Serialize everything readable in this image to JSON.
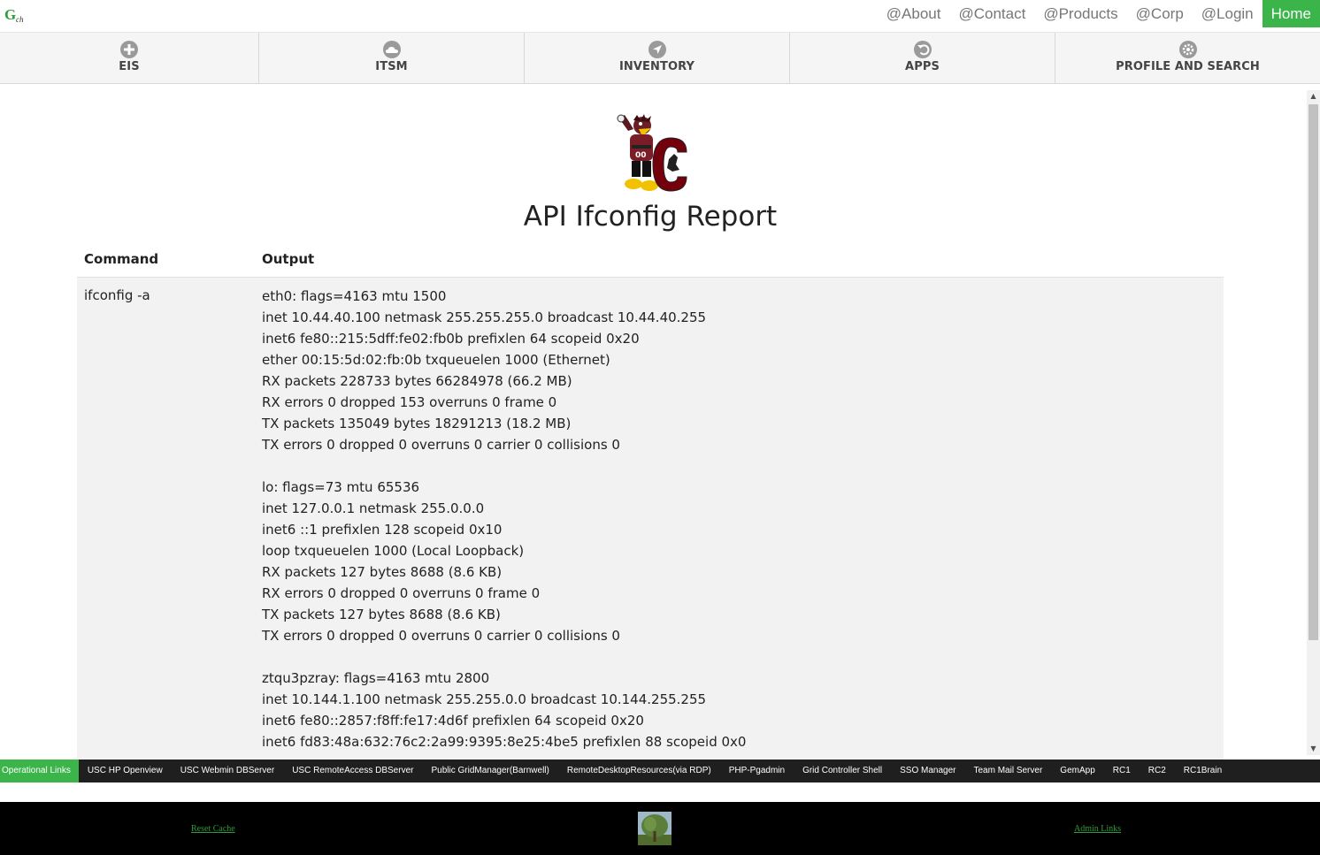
{
  "topnav": {
    "links": [
      "@About",
      "@Contact",
      "@Products",
      "@Corp",
      "@Login"
    ],
    "home": "Home",
    "colors": {
      "accent": "#3bb54a",
      "link": "#777777"
    }
  },
  "tabs": [
    {
      "label": "EIS",
      "icon": "plus-circle-icon"
    },
    {
      "label": "ITSM",
      "icon": "cloud-icon"
    },
    {
      "label": "INVENTORY",
      "icon": "navigation-arrow-icon"
    },
    {
      "label": "APPS",
      "icon": "refresh-back-icon"
    },
    {
      "label": "PROFILE AND SEARCH",
      "icon": "gear-icon"
    }
  ],
  "main": {
    "title": "API Ifconfig Report",
    "table": {
      "headers": [
        "Command",
        "Output"
      ],
      "command": "ifconfig -a",
      "output_lines": [
        "eth0: flags=4163 mtu 1500",
        "inet 10.44.40.100 netmask 255.255.255.0 broadcast 10.44.40.255",
        "inet6 fe80::215:5dff:fe02:fb0b prefixlen 64 scopeid 0x20",
        "ether 00:15:5d:02:fb:0b txqueuelen 1000 (Ethernet)",
        "RX packets 228733 bytes 66284978 (66.2 MB)",
        "RX errors 0 dropped 153 overruns 0 frame 0",
        "TX packets 135049 bytes 18291213 (18.2 MB)",
        "TX errors 0 dropped 0 overruns 0 carrier 0 collisions 0",
        "",
        "lo: flags=73 mtu 65536",
        "inet 127.0.0.1 netmask 255.0.0.0",
        "inet6 ::1 prefixlen 128 scopeid 0x10",
        "loop txqueuelen 1000 (Local Loopback)",
        "RX packets 127 bytes 8688 (8.6 KB)",
        "RX errors 0 dropped 0 overruns 0 frame 0",
        "TX packets 127 bytes 8688 (8.6 KB)",
        "TX errors 0 dropped 0 overruns 0 carrier 0 collisions 0",
        "",
        "ztqu3pzray: flags=4163 mtu 2800",
        "inet 10.144.1.100 netmask 255.255.0.0 broadcast 10.144.255.255",
        "inet6 fe80::2857:f8ff:fe17:4d6f prefixlen 64 scopeid 0x20",
        "inet6 fd83:48a:632:76c2:2a99:9395:8e25:4be5 prefixlen 88 scopeid 0x0"
      ]
    }
  },
  "oplinks": [
    "Operational Links",
    "USC HP Openview",
    "USC Webmin DBServer",
    "USC RemoteAccess DBServer",
    "Public GridManager(Barnwell)",
    "RemoteDesktopResources(via RDP)",
    "PHP-Pgadmin",
    "Grid Controller Shell",
    "SSO Manager",
    "Team Mail Server",
    "GemApp",
    "RC1",
    "RC2",
    "RC1Brain"
  ],
  "footer": {
    "left_link": "Reset Cache",
    "right_link": "Admin Links",
    "center_image": "tree-thumbnail"
  }
}
